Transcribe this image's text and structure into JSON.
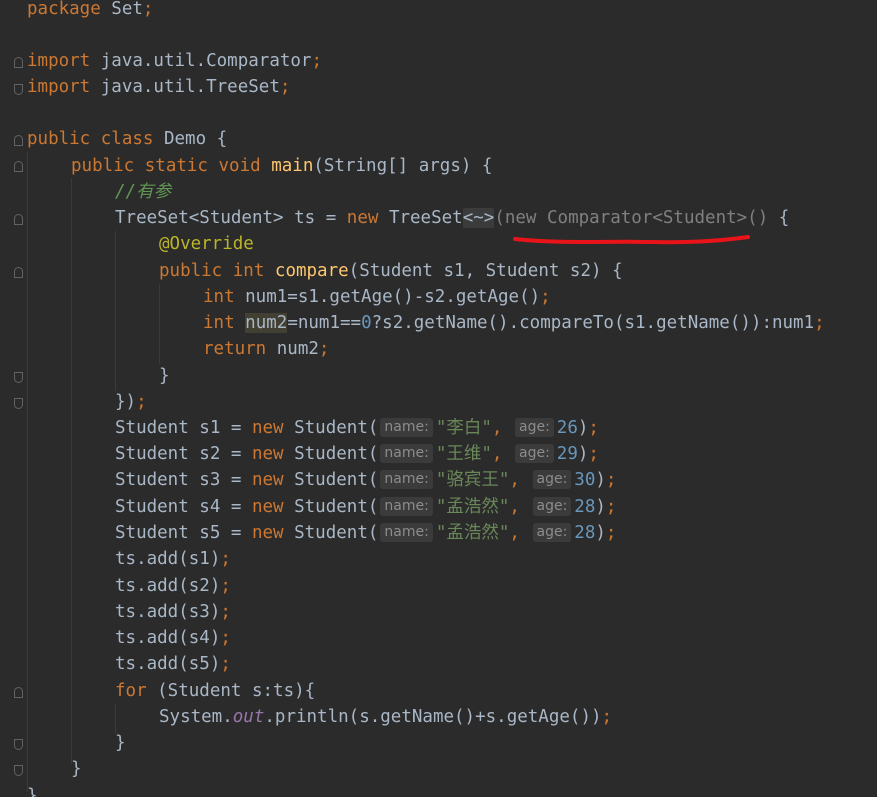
{
  "code": {
    "l1_package": "package",
    "l1_name": " Set",
    "l1_semi": ";",
    "l3_import": "import",
    "l3_path": " java.util.Comparator",
    "l3_semi": ";",
    "l4_import": "import",
    "l4_path": " java.util.TreeSet",
    "l4_semi": ";",
    "l6_public": "public",
    "l6_class": " class",
    "l6_rest": " Demo {",
    "l7_public": "public",
    "l7_static": " static",
    "l7_void": " void",
    "l7_main": " main",
    "l7_rest": "(String[] args) {",
    "l8_comment": "//有参",
    "l9_a": "TreeSet<Student> ts = ",
    "l9_new": "new",
    "l9_b": " TreeSet",
    "l9_diamond": "<~>",
    "l9_grey": "(new Comparator<Student>()",
    "l9_end": " {",
    "l10_override": "@Override",
    "l11_public": "public",
    "l11_int": " int",
    "l11_compare": " compare",
    "l11_rest": "(Student s1, Student s2) {",
    "l12_int": "int",
    "l12_rest": " num1=s1.getAge()-s2.getAge()",
    "l12_semi": ";",
    "l13_int": "int",
    "l13_sp": " ",
    "l13_var": "num2",
    "l13_a": "=num1==",
    "l13_zero": "0",
    "l13_b": "?s2.getName().compareTo(s1.getName()):num1",
    "l13_semi": ";",
    "l14_return": "return",
    "l14_rest": " num2",
    "l14_semi": ";",
    "l15_brace": "}",
    "l16_close": "})",
    "l16_semi": ";",
    "students": [
      {
        "decl": "Student s1 = ",
        "name": "\"李白\"",
        "age": "26"
      },
      {
        "decl": "Student s2 = ",
        "name": "\"王维\"",
        "age": "29"
      },
      {
        "decl": "Student s3 = ",
        "name": "\"骆宾王\"",
        "age": "30"
      },
      {
        "decl": "Student s4 = ",
        "name": "\"孟浩然\"",
        "age": "28"
      },
      {
        "decl": "Student s5 = ",
        "name": "\"孟浩然\"",
        "age": "28"
      }
    ],
    "new_kw": "new",
    "student_ctor": " Student(",
    "hint_name": "name:",
    "hint_age": "age:",
    "comma": ",",
    "close_paren": ")",
    "semi": ";",
    "adds": [
      "ts.add(s1)",
      "ts.add(s2)",
      "ts.add(s3)",
      "ts.add(s4)",
      "ts.add(s5)"
    ],
    "for_kw": "for",
    "for_rest": " (Student s:ts){",
    "println_a": "System.",
    "println_out": "out",
    "println_b": ".println(s.getName()+s.getAge())",
    "close_for": "}",
    "close_main": "}",
    "close_class": "}"
  },
  "colors": {
    "background": "#2b2b2b",
    "keyword": "#cc7832",
    "string": "#6a8759",
    "number": "#6897bb",
    "method": "#ffc66d",
    "annotation": "#bbb529",
    "comment": "#629755",
    "default_text": "#a9b7c6",
    "red_underline": "#e8141a"
  }
}
